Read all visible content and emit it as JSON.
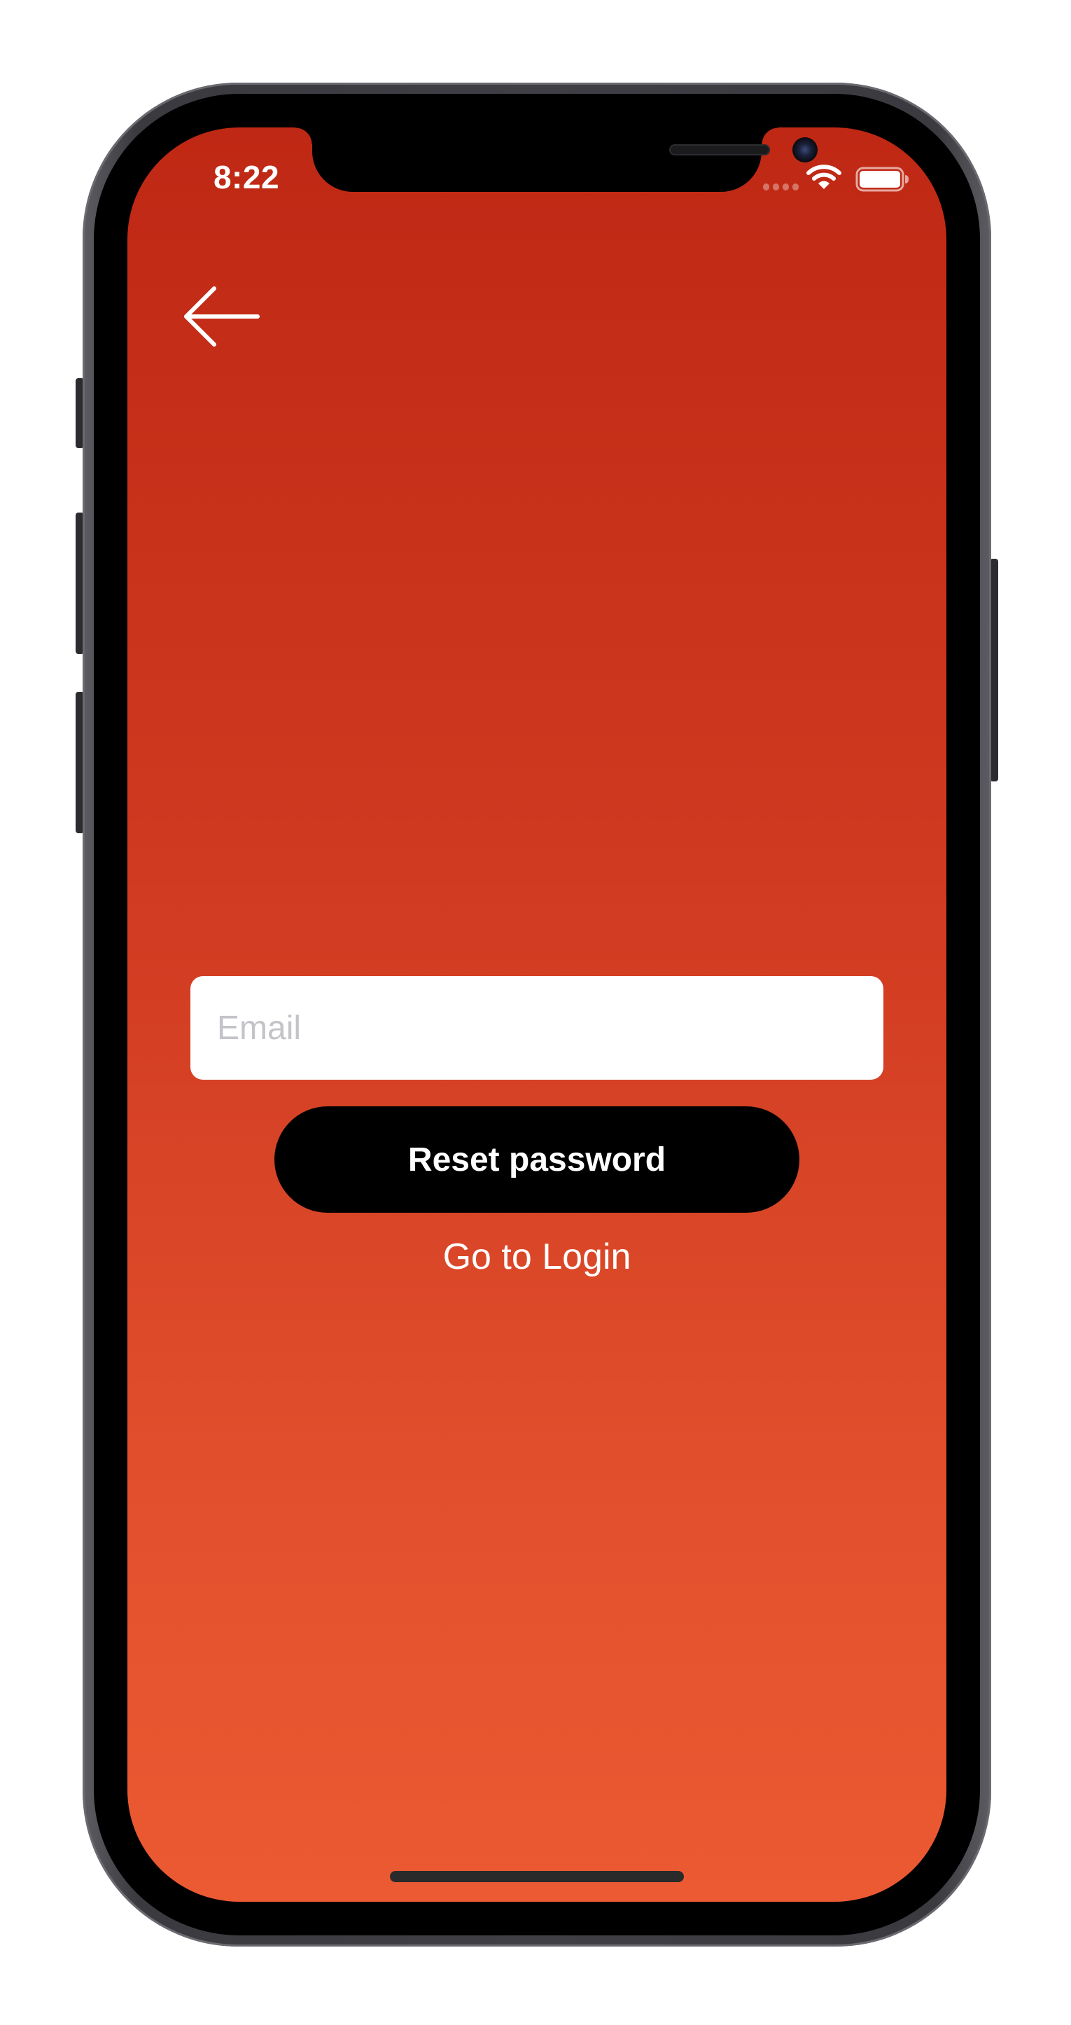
{
  "status_bar": {
    "time": "8:22"
  },
  "icons": {
    "back": "arrow-left-icon",
    "wifi": "wifi-icon",
    "battery": "battery-icon",
    "signal": "signal-icon"
  },
  "form": {
    "email_placeholder": "Email",
    "email_value": "",
    "reset_label": "Reset password",
    "login_link_label": "Go to Login"
  },
  "colors": {
    "background_top": "#bf2814",
    "background_bottom": "#ec5a33",
    "button_bg": "#000000",
    "text": "#ffffff"
  }
}
